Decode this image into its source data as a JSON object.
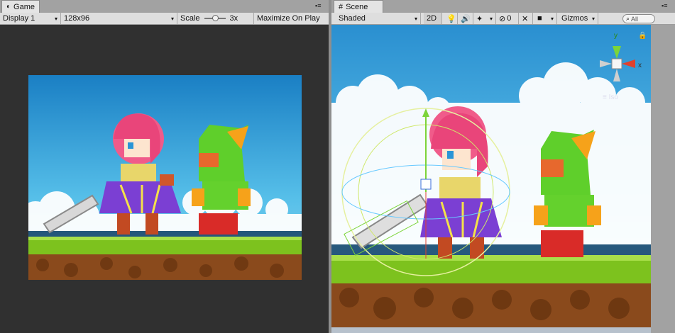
{
  "game": {
    "tab_label": "Game",
    "display_label": "Display 1",
    "resolution_label": "128x96",
    "scale_label": "Scale",
    "scale_value": "3x",
    "maximize_label": "Maximize On Play"
  },
  "scene": {
    "tab_label": "Scene",
    "shading_label": "Shaded",
    "mode_2d_label": "2D",
    "hidden_count": "0",
    "gizmos_label": "Gizmos",
    "search_placeholder": "All",
    "axis_x": "x",
    "axis_y": "y",
    "projection_label": "Iso"
  },
  "colors": {
    "panel_bg": "#303030",
    "toolbar_bg": "#dedede",
    "sky": "#2fa3d9",
    "grass": "#7dc21e",
    "dirt": "#8a4a1c",
    "gizmo_green": "#7cd43a",
    "gizmo_red": "#e0412d"
  }
}
